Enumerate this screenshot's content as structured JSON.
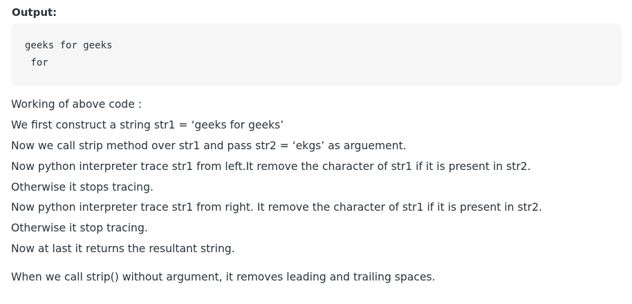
{
  "output": {
    "heading": "Output:",
    "code_lines": [
      "geeks for geeks",
      " for"
    ]
  },
  "explanation": {
    "lines": [
      "Working of above code :",
      "We first construct a string str1 = ‘geeks for geeks’",
      "Now we call strip method over str1 and pass str2 = ‘ekgs’ as arguement.",
      "Now python interpreter trace str1 from left.It remove the character of str1 if it is present in str2.",
      "Otherwise it stops tracing.",
      "Now python interpreter trace str1 from right. It remove the character of str1 if it is present in str2.",
      "Otherwise it stop tracing.",
      "Now at last it returns the resultant string."
    ],
    "note": "When we call strip() without argument, it removes leading and trailing spaces."
  }
}
